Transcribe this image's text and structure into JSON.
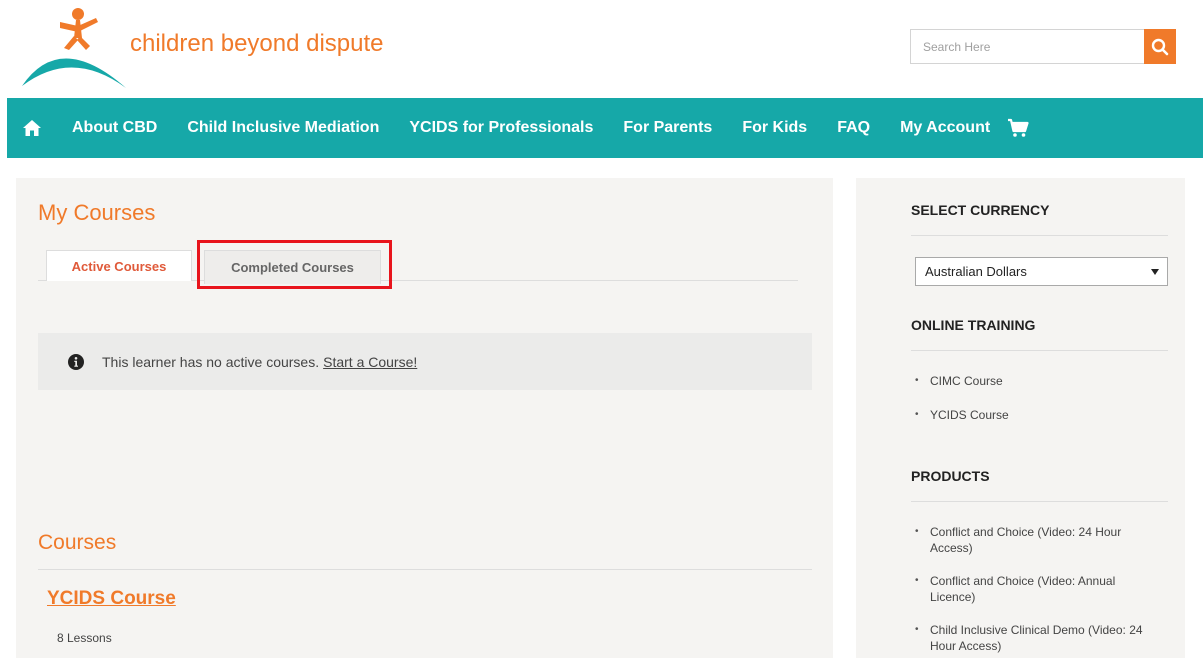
{
  "header": {
    "brand": "children beyond dispute",
    "search_placeholder": "Search Here"
  },
  "nav": {
    "items": [
      "About CBD",
      "Child Inclusive Mediation",
      "YCIDS for Professionals",
      "For Parents",
      "For Kids",
      "FAQ",
      "My Account"
    ],
    "icons": {
      "home": "home-icon",
      "cart": "cart-icon"
    }
  },
  "main": {
    "page_title": "My Courses",
    "tabs": [
      {
        "label": "Active Courses",
        "active": true
      },
      {
        "label": "Completed Courses",
        "active": false
      }
    ],
    "notice": {
      "text": "This learner has no active courses.",
      "link": "Start a Course!"
    },
    "courses_title": "Courses",
    "course": {
      "name": "YCIDS Course",
      "lessons": "8 Lessons"
    }
  },
  "sidebar": {
    "currency_heading": "SELECT CURRENCY",
    "currency_selected": "Australian Dollars",
    "online_training_heading": "ONLINE TRAINING",
    "online_training": [
      "CIMC Course",
      "YCIDS Course"
    ],
    "products_heading": "PRODUCTS",
    "products": [
      "Conflict and Choice (Video: 24 Hour Access)",
      "Conflict and Choice (Video: Annual Licence)",
      "Child Inclusive Clinical Demo (Video: 24 Hour Access)"
    ]
  },
  "colors": {
    "accent": "#f07a2a",
    "nav": "#16a8a8",
    "highlight": "#e8141c"
  }
}
